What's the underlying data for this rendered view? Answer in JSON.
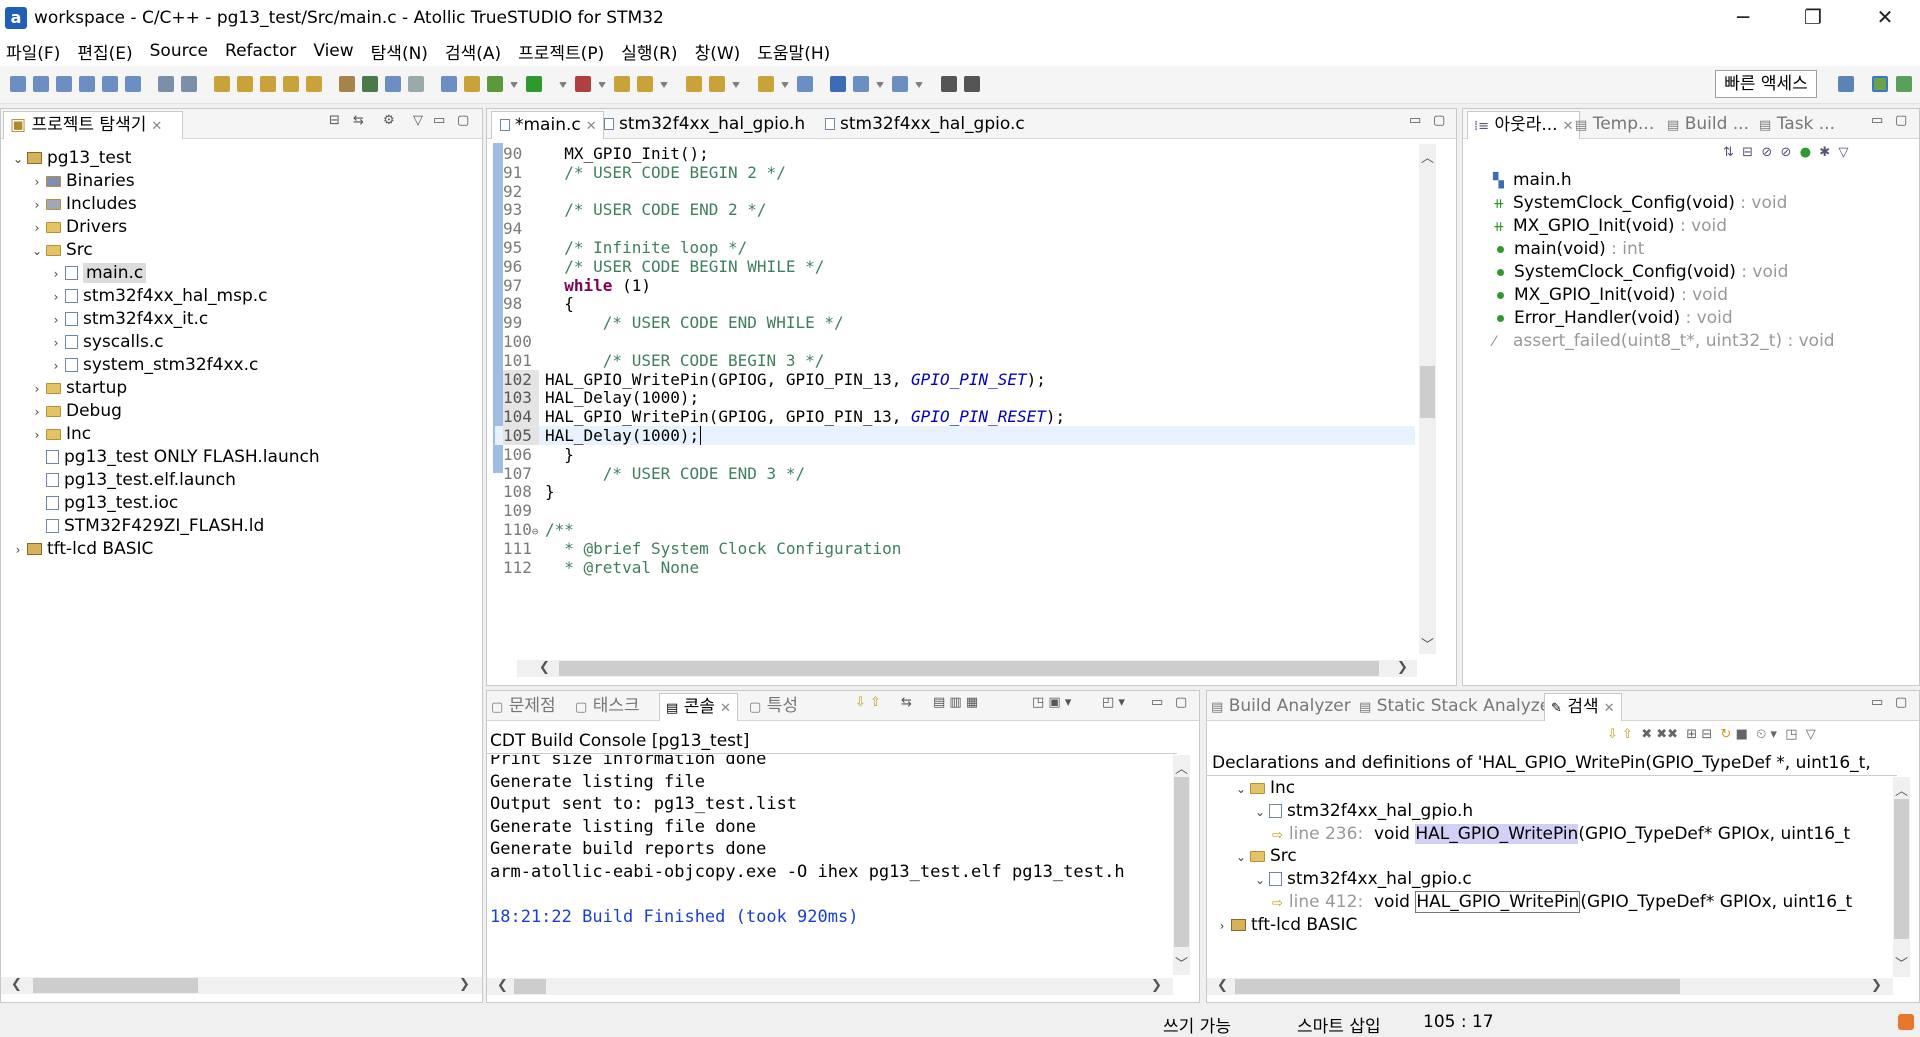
{
  "window": {
    "title": "workspace - C/C++ - pg13_test/Src/main.c - Atollic TrueSTUDIO for STM32",
    "app_icon": "a",
    "minimize": "─",
    "maximize": "❐",
    "close": "✕"
  },
  "menu": [
    "파일(F)",
    "편집(E)",
    "Source",
    "Refactor",
    "View",
    "탐색(N)",
    "검색(A)",
    "프로젝트(P)",
    "실행(R)",
    "창(W)",
    "도움말(H)"
  ],
  "toolbar": {
    "quick_access": "빠른 액세스"
  },
  "explorer": {
    "tab": "프로젝트 탐색기",
    "items": [
      {
        "label": "pg13_test",
        "level": 0,
        "type": "project",
        "twisty": "⌄"
      },
      {
        "label": "Binaries",
        "level": 1,
        "type": "bin",
        "twisty": "›"
      },
      {
        "label": "Includes",
        "level": 1,
        "type": "inc",
        "twisty": "›"
      },
      {
        "label": "Drivers",
        "level": 1,
        "type": "folder",
        "twisty": "›"
      },
      {
        "label": "Src",
        "level": 1,
        "type": "folder",
        "twisty": "⌄"
      },
      {
        "label": "main.c",
        "level": 2,
        "type": "file",
        "twisty": "›",
        "selected": true
      },
      {
        "label": "stm32f4xx_hal_msp.c",
        "level": 2,
        "type": "file",
        "twisty": "›"
      },
      {
        "label": "stm32f4xx_it.c",
        "level": 2,
        "type": "file",
        "twisty": "›"
      },
      {
        "label": "syscalls.c",
        "level": 2,
        "type": "file",
        "twisty": "›"
      },
      {
        "label": "system_stm32f4xx.c",
        "level": 2,
        "type": "file",
        "twisty": "›"
      },
      {
        "label": "startup",
        "level": 1,
        "type": "folder",
        "twisty": "›"
      },
      {
        "label": "Debug",
        "level": 1,
        "type": "folder",
        "twisty": "›"
      },
      {
        "label": "Inc",
        "level": 1,
        "type": "folder",
        "twisty": "›"
      },
      {
        "label": "pg13_test ONLY FLASH.launch",
        "level": 1,
        "type": "file",
        "twisty": ""
      },
      {
        "label": "pg13_test.elf.launch",
        "level": 1,
        "type": "file",
        "twisty": ""
      },
      {
        "label": "pg13_test.ioc",
        "level": 1,
        "type": "file",
        "twisty": ""
      },
      {
        "label": "STM32F429ZI_FLASH.ld",
        "level": 1,
        "type": "file",
        "twisty": ""
      },
      {
        "label": "tft-lcd BASIC",
        "level": 0,
        "type": "project",
        "twisty": "›"
      }
    ]
  },
  "editor": {
    "tabs": [
      {
        "label": "*main.c",
        "active": true
      },
      {
        "label": "stm32f4xx_hal_gpio.h"
      },
      {
        "label": "stm32f4xx_hal_gpio.c"
      }
    ],
    "lines": [
      {
        "n": "90",
        "t": "  MX_GPIO_Init();",
        "c": ""
      },
      {
        "n": "91",
        "t": "  /* USER CODE BEGIN 2 */",
        "c": "cm"
      },
      {
        "n": "92",
        "t": "",
        "c": ""
      },
      {
        "n": "93",
        "t": "  /* USER CODE END 2 */",
        "c": "cm"
      },
      {
        "n": "94",
        "t": "",
        "c": ""
      },
      {
        "n": "95",
        "t": "  /* Infinite loop */",
        "c": "cm"
      },
      {
        "n": "96",
        "t": "  /* USER CODE BEGIN WHILE */",
        "c": "cm"
      },
      {
        "n": "97",
        "t": "  while (1)",
        "c": "while"
      },
      {
        "n": "98",
        "t": "  {",
        "c": ""
      },
      {
        "n": "99",
        "t": "      /* USER CODE END WHILE */",
        "c": "cm"
      },
      {
        "n": "100",
        "t": "",
        "c": ""
      },
      {
        "n": "101",
        "t": "      /* USER CODE BEGIN 3 */",
        "c": "cm"
      },
      {
        "n": "102",
        "t": "HAL_GPIO_WritePin(GPIOG, GPIO_PIN_13, |GPIO_PIN_SET|);",
        "c": "enum"
      },
      {
        "n": "103",
        "t": "HAL_Delay(1000);",
        "c": ""
      },
      {
        "n": "104",
        "t": "HAL_GPIO_WritePin(GPIOG, GPIO_PIN_13, |GPIO_PIN_RESET|);",
        "c": "enum"
      },
      {
        "n": "105",
        "t": "HAL_Delay(1000);",
        "c": "current"
      },
      {
        "n": "106",
        "t": "  }",
        "c": ""
      },
      {
        "n": "107",
        "t": "      /* USER CODE END 3 */",
        "c": "cm"
      },
      {
        "n": "108",
        "t": "}",
        "c": ""
      },
      {
        "n": "109",
        "t": "",
        "c": ""
      },
      {
        "n": "110",
        "t": "/**",
        "c": "cm"
      },
      {
        "n": "111",
        "t": "  * @brief System Clock Configuration",
        "c": "cm"
      },
      {
        "n": "112",
        "t": "  * @retval None",
        "c": "cm"
      }
    ]
  },
  "outline": {
    "tabs": [
      "아웃라...",
      "Temp...",
      "Build ...",
      "Task ..."
    ],
    "items": [
      {
        "name": "main.h",
        "type": "",
        "kind": "include"
      },
      {
        "name": "SystemClock_Config(void)",
        "type": " : void",
        "kind": "hash"
      },
      {
        "name": "MX_GPIO_Init(void)",
        "type": " : void",
        "kind": "hash"
      },
      {
        "name": "main(void)",
        "type": " : int",
        "kind": "dot"
      },
      {
        "name": "SystemClock_Config(void)",
        "type": " : void",
        "kind": "dot"
      },
      {
        "name": "MX_GPIO_Init(void)",
        "type": " : void",
        "kind": "dot"
      },
      {
        "name": "Error_Handler(void)",
        "type": " : void",
        "kind": "dot"
      },
      {
        "name": "assert_failed(uint8_t*, uint32_t)",
        "type": " : void",
        "kind": "pen",
        "dim": true
      }
    ]
  },
  "console": {
    "tabs": [
      "문제점",
      "태스크",
      "콘솔",
      "특성"
    ],
    "header": "CDT Build Console [pg13_test]",
    "lines": [
      "Print size information done",
      "Generate listing file",
      "Output sent to: pg13_test.list",
      "Generate listing file done",
      "Generate build reports done",
      "arm-atollic-eabi-objcopy.exe -O ihex pg13_test.elf pg13_test.h",
      "",
      "18:21:22 Build Finished (took 920ms)"
    ]
  },
  "search": {
    "tabs": [
      "Build Analyzer",
      "Static Stack Analyzer",
      "검색"
    ],
    "header": "Declarations and definitions of 'HAL_GPIO_WritePin(GPIO_TypeDef *, uint16_t,",
    "tree": [
      {
        "label": "Inc",
        "level": 1,
        "type": "folder",
        "twisty": "⌄"
      },
      {
        "label": "stm32f4xx_hal_gpio.h",
        "level": 2,
        "type": "file",
        "twisty": "⌄"
      },
      {
        "line": "line 236:",
        "pre": "void ",
        "match": "HAL_GPIO_WritePin",
        "post": "(GPIO_TypeDef* GPIOx, uint16_t",
        "level": 3,
        "type": "match"
      },
      {
        "label": "Src",
        "level": 1,
        "type": "folder",
        "twisty": "⌄"
      },
      {
        "label": "stm32f4xx_hal_gpio.c",
        "level": 2,
        "type": "file",
        "twisty": "⌄"
      },
      {
        "line": "line 412:",
        "pre": "void ",
        "match": "HAL_GPIO_WritePin",
        "post": "(GPIO_TypeDef* GPIOx, uint16_t",
        "level": 3,
        "type": "match"
      },
      {
        "label": "tft-lcd BASIC",
        "level": 0,
        "type": "project",
        "twisty": "›"
      }
    ]
  },
  "status": {
    "write": "쓰기 가능",
    "insert": "스마트 삽입",
    "position": "105 : 17"
  }
}
